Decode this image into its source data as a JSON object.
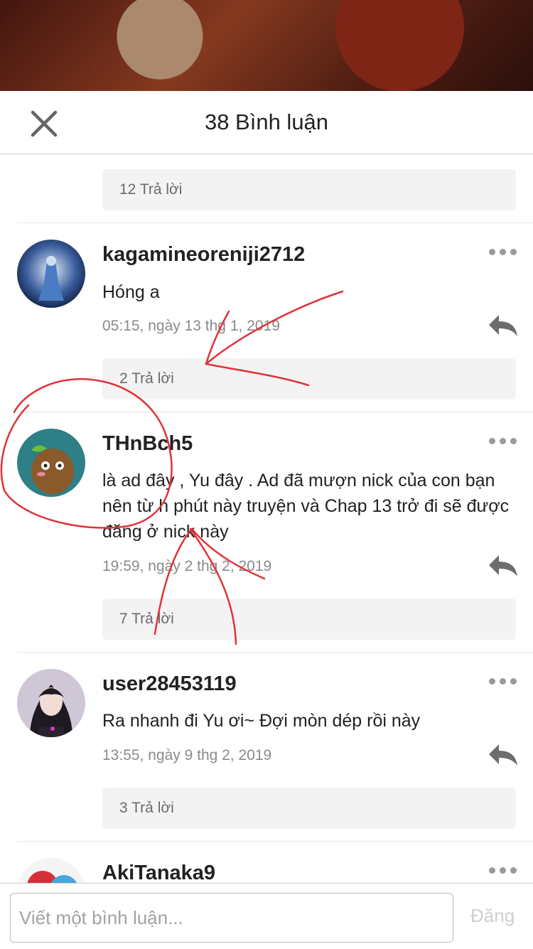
{
  "sheet": {
    "title": "38 Bình luận"
  },
  "top_reply": {
    "label": "12 Trả lời"
  },
  "comments": [
    {
      "username": "kagamineoreniji2712",
      "text": "Hóng a",
      "time": "05:15, ngày 13 thg 1, 2019",
      "replies": "2 Trả lời"
    },
    {
      "username": "THnBch5",
      "text": "là ad đây , Yu đây . Ad đã mượn nick của con bạn nên từ h phút này truyện và Chap 13 trở đi sẽ được đăng ở nick này",
      "time": "19:59, ngày 2 thg 2, 2019",
      "replies": "7 Trả lời"
    },
    {
      "username": "user28453119",
      "text": "Ra nhanh đi Yu ơi~ Đợi mòn dép rồi này",
      "time": "13:55, ngày 9 thg 2, 2019",
      "replies": "3 Trả lời"
    },
    {
      "username": "AkiTanaka9"
    }
  ],
  "composer": {
    "placeholder": "Viết một bình luận...",
    "post_label": "Đăng"
  },
  "colors": {
    "scribble": "#e0333a",
    "muted": "#9a9a9a"
  }
}
